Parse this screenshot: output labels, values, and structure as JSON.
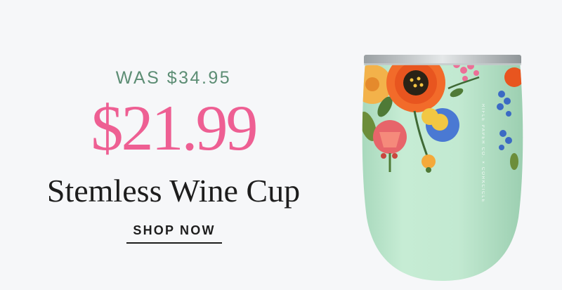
{
  "promo": {
    "was_price": "WAS $34.95",
    "sale_price": "$21.99",
    "product_name": "Stemless Wine Cup",
    "cta_label": "SHOP NOW"
  },
  "cup_image": {
    "side_text": "RIFLE PAPER CO. × CORKCICLE",
    "icon": "stemless-wine-cup-floral-image"
  },
  "colors": {
    "background": "#f6f7f9",
    "was_price": "#5c8d74",
    "sale_price": "#ee5f93",
    "text_dark": "#1d1d1d",
    "cup_mint": "#bfe8cf"
  }
}
